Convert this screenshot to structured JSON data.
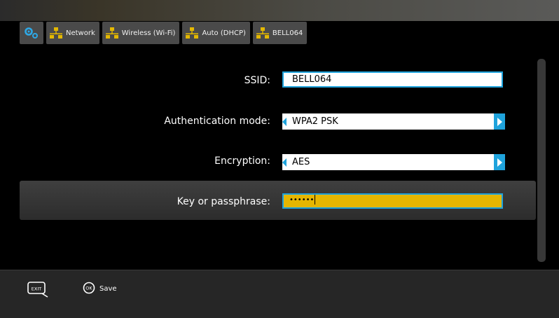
{
  "breadcrumb": [
    {
      "label": "Network",
      "icon": "network-icon"
    },
    {
      "label": "Wireless (Wi-Fi)",
      "icon": "wifi-network-icon"
    },
    {
      "label": "Auto (DHCP)",
      "icon": "dhcp-network-icon"
    },
    {
      "label": "BELL064",
      "icon": "network-icon"
    }
  ],
  "form": {
    "ssid_label": "SSID:",
    "ssid_value": "BELL064",
    "auth_label": "Authentication mode:",
    "auth_value": "WPA2 PSK",
    "enc_label": "Encryption:",
    "enc_value": "AES",
    "key_label": "Key or passphrase:",
    "key_value": "••••••"
  },
  "footer": {
    "exit_label": "EXIT",
    "ok_label": "OK",
    "save_label": "Save"
  },
  "colors": {
    "accent": "#1fa3dc",
    "highlight_field": "#e5b600",
    "network_icon": "#e4b800"
  }
}
